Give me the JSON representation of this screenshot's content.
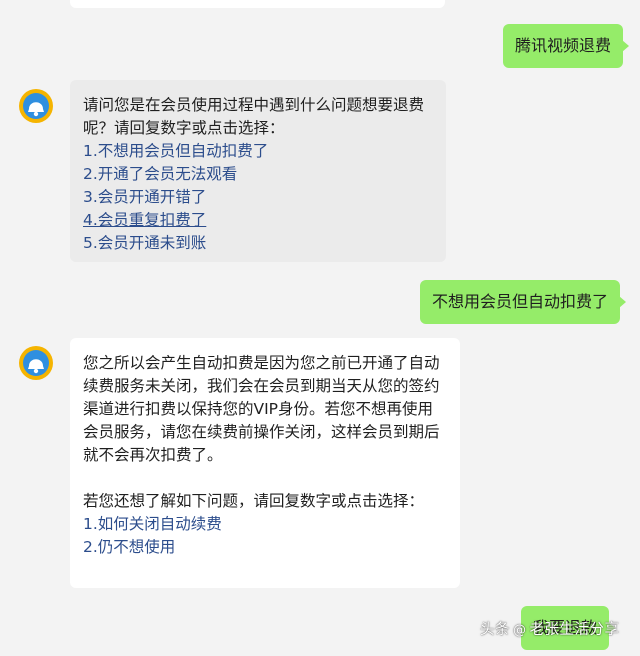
{
  "conversation": [
    {
      "id": "msg1",
      "side": "right",
      "text": "腾讯视频退费"
    },
    {
      "id": "msg2",
      "side": "left",
      "intro": "请问您是在会员使用过程中遇到什么问题想要退费呢？请回复数字或点击选择：",
      "options": [
        "1.不想用会员但自动扣费了",
        "2.开通了会员无法观看",
        "3.会员开通开错了",
        "4.会员重复扣费了",
        "5.会员开通未到账"
      ]
    },
    {
      "id": "msg3",
      "side": "right",
      "text": "不想用会员但自动扣费了"
    },
    {
      "id": "msg4",
      "side": "left",
      "intro": "您之所以会产生自动扣费是因为您之前已开通了自动续费服务未关闭，我们会在会员到期当天从您的签约渠道进行扣费以保持您的VIP身份。若您不想再使用会员服务，请您在续费前操作关闭，这样会员到期后就不会再次扣费了。",
      "followup": "若您还想了解如下问题，请回复数字或点击选择：",
      "options": [
        "1.如何关闭自动续费",
        "2.仍不想使用"
      ]
    },
    {
      "id": "msg5",
      "side": "right",
      "text": "我要退款"
    }
  ],
  "watermark": {
    "platform": "头条",
    "at": "@",
    "account": "老张生活分享"
  }
}
